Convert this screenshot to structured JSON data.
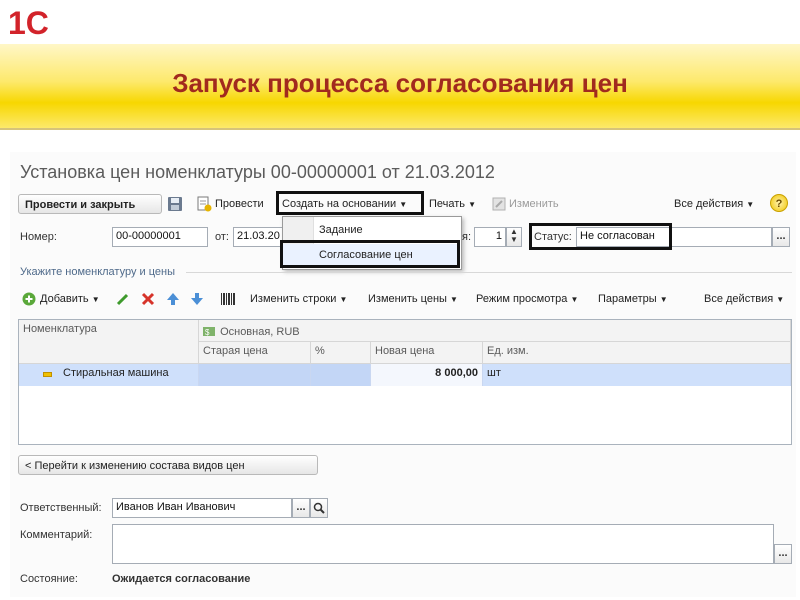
{
  "slide": {
    "logo_text": "1С",
    "title": "Запуск процесса согласования цен"
  },
  "form": {
    "title": "Установка цен номенклатуры 00-00000001 от 21.03.2012",
    "toolbar": {
      "post_close": "Провести и закрыть",
      "post": "Провести",
      "create_based": "Создать на основании",
      "print": "Печать",
      "edit": "Изменить",
      "all_actions": "Все действия",
      "help": "?"
    },
    "create_menu": {
      "items": [
        "Задание",
        "Согласование цен"
      ]
    },
    "number_label": "Номер:",
    "number_value": "00-00000001",
    "date_label": "от:",
    "date_value": "21.03.20",
    "version_label_tail": "я:",
    "version_value": "1",
    "status_label": "Статус:",
    "status_value": "Не согласован",
    "section_label": "Укажите номенклатуру и цены",
    "table_toolbar": {
      "add": "Добавить",
      "change_rows": "Изменить строки",
      "change_prices": "Изменить цены",
      "view_mode": "Режим просмотра",
      "parameters": "Параметры",
      "all_actions": "Все действия"
    },
    "table": {
      "col_item": "Номенклатура",
      "price_type": "Основная, RUB",
      "col_old_price": "Старая цена",
      "col_percent": "%",
      "col_new_price": "Новая цена",
      "col_unit": "Ед. изм.",
      "rows": [
        {
          "item": "Стиральная машина",
          "old_price": "",
          "percent": "",
          "new_price": "8 000,00",
          "unit": "шт"
        }
      ]
    },
    "go_to_button": "< Перейти к изменению состава видов цен",
    "responsible_label": "Ответственный:",
    "responsible_value": "Иванов Иван Иванович",
    "comment_label": "Комментарий:",
    "comment_value": "",
    "state_label": "Состояние:",
    "state_value": "Ожидается согласование"
  },
  "colors": {
    "brand_red": "#d2232a",
    "title_red": "#a12a1e",
    "banner_yellow": "#f7d700",
    "selection_blue": "#cfe0fb",
    "highlight_border": "#111111"
  },
  "icons": [
    "save-icon",
    "post-icon",
    "edit-doc-icon",
    "add-icon",
    "pencil-icon",
    "delete-icon",
    "arrow-up-icon",
    "arrow-down-icon",
    "barcode-icon",
    "search-icon",
    "currency-icon",
    "row-marker-icon"
  ]
}
